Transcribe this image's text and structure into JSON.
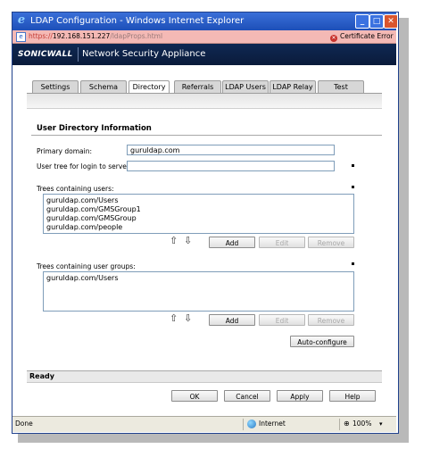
{
  "window": {
    "title": "LDAP Configuration - Windows Internet Explorer",
    "min_label": "_",
    "max_label": "□",
    "close_label": "✕"
  },
  "address": {
    "scheme": "https://",
    "host": "192.168.151.227",
    "path": "/ldapProps.html",
    "cert_error": "Certificate Error"
  },
  "header": {
    "logo": "SONICWALL",
    "product": "Network Security Appliance"
  },
  "tabs": [
    {
      "label": "Settings"
    },
    {
      "label": "Schema"
    },
    {
      "label": "Directory"
    },
    {
      "label": "Referrals"
    },
    {
      "label": "LDAP Users"
    },
    {
      "label": "LDAP Relay"
    },
    {
      "label": "Test"
    }
  ],
  "form": {
    "section_title": "User Directory Information",
    "primary_domain_label": "Primary domain:",
    "primary_domain_value": "guruldap.com",
    "user_tree_label": "User tree for login to server:",
    "user_tree_value": "",
    "trees_users_label": "Trees containing users:",
    "trees_users": [
      "guruldap.com/Users",
      "guruldap.com/GMSGroup1",
      "guruldap.com/GMSGroup",
      "guruldap.com/people"
    ],
    "trees_groups_label": "Trees containing user groups:",
    "trees_groups": [
      "guruldap.com/Users"
    ],
    "add_label": "Add",
    "edit_label": "Edit",
    "remove_label": "Remove",
    "up_arrow": "⇧",
    "down_arrow": "⇩",
    "auto_configure_label": "Auto-configure"
  },
  "status_panel": {
    "text": "Ready"
  },
  "dialog_buttons": {
    "ok": "OK",
    "cancel": "Cancel",
    "apply": "Apply",
    "help": "Help"
  },
  "statusbar": {
    "left": "Done",
    "zone": "Internet",
    "zoom": "100%",
    "zoom_caret": "▾"
  }
}
